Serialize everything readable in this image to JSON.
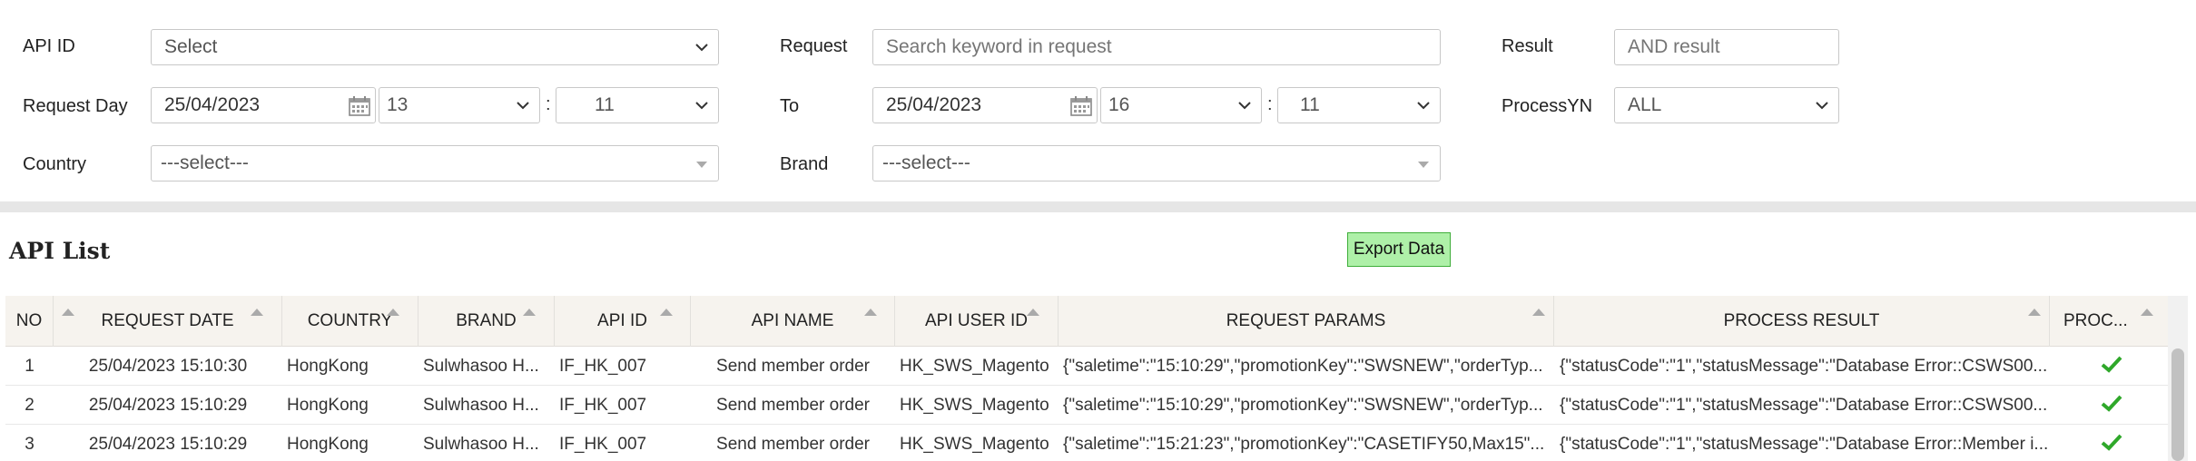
{
  "filters": {
    "api_id": {
      "label": "API ID",
      "value": "Select"
    },
    "request": {
      "label": "Request",
      "placeholder": "Search keyword in request"
    },
    "result": {
      "label": "Result",
      "placeholder": "AND result"
    },
    "request_day": {
      "label": "Request Day",
      "date": "25/04/2023",
      "hour": "13",
      "minute": "11"
    },
    "to": {
      "label": "To",
      "date": "25/04/2023",
      "hour": "16",
      "minute": "11"
    },
    "process_yn": {
      "label": "ProcessYN",
      "value": "ALL"
    },
    "country": {
      "label": "Country",
      "value": "---select---"
    },
    "brand": {
      "label": "Brand",
      "value": "---select---"
    },
    "time_separator": ":"
  },
  "list": {
    "title": "API List",
    "export_label": "Export Data",
    "columns": [
      "NO",
      "REQUEST DATE",
      "COUNTRY",
      "BRAND",
      "API ID",
      "API NAME",
      "API USER ID",
      "REQUEST PARAMS",
      "PROCESS RESULT",
      "PROC..."
    ],
    "rows": [
      {
        "no": "1",
        "date": "25/04/2023 15:10:30",
        "country": "HongKong",
        "brand": "Sulwhasoo H...",
        "api_id": "IF_HK_007",
        "api_name": "Send member order",
        "user_id": "HK_SWS_Magento",
        "params": "{\"saletime\":\"15:10:29\",\"promotionKey\":\"SWSNEW\",\"orderTyp...",
        "result": "{\"statusCode\":\"1\",\"statusMessage\":\"Database Error::CSWS00..."
      },
      {
        "no": "2",
        "date": "25/04/2023 15:10:29",
        "country": "HongKong",
        "brand": "Sulwhasoo H...",
        "api_id": "IF_HK_007",
        "api_name": "Send member order",
        "user_id": "HK_SWS_Magento",
        "params": "{\"saletime\":\"15:10:29\",\"promotionKey\":\"SWSNEW\",\"orderTyp...",
        "result": "{\"statusCode\":\"1\",\"statusMessage\":\"Database Error::CSWS00..."
      },
      {
        "no": "3",
        "date": "25/04/2023 15:10:29",
        "country": "HongKong",
        "brand": "Sulwhasoo H...",
        "api_id": "IF_HK_007",
        "api_name": "Send member order",
        "user_id": "HK_SWS_Magento",
        "params": "{\"saletime\":\"15:21:23\",\"promotionKey\":\"CASETIFY50,Max15\"...",
        "result": "{\"statusCode\":\"1\",\"statusMessage\":\"Database Error::Member i..."
      }
    ]
  },
  "colors": {
    "accent_green": "#2fa82a",
    "export_bg": "#aef0a8",
    "header_bg": "#f6f3ee"
  },
  "icons": {
    "calendar": "calendar-icon",
    "dropdown": "chevron-down-icon",
    "processed": "check-icon",
    "sort": "sort-icon"
  }
}
